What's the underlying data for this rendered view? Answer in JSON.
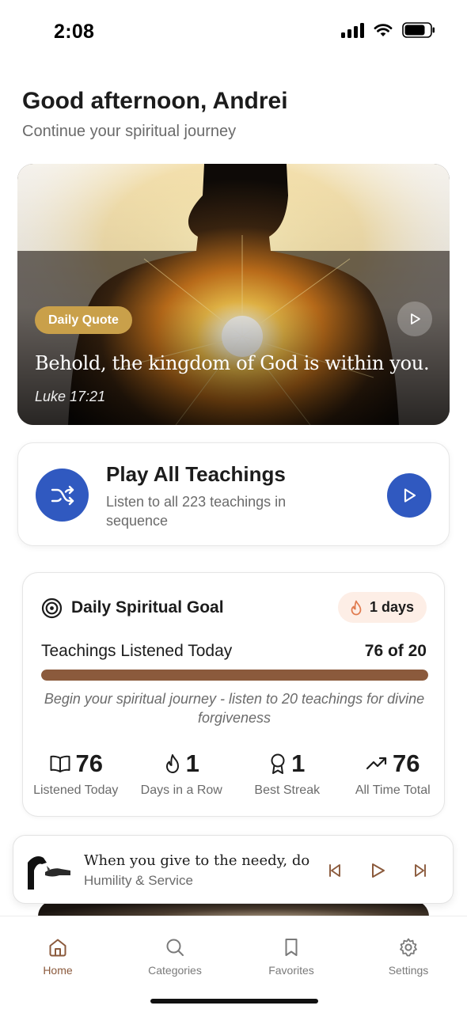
{
  "status_bar": {
    "time": "2:08"
  },
  "header": {
    "greeting": "Good afternoon, Andrei",
    "subtitle": "Continue your spiritual journey"
  },
  "hero": {
    "badge": "Daily Quote",
    "quote": "Behold, the kingdom of God is within you.",
    "reference": "Luke 17:21",
    "play_icon": "play-icon"
  },
  "play_all": {
    "title": "Play All Teachings",
    "subtitle": "Listen to all 223 teachings in sequence",
    "shuffle_icon": "shuffle-icon",
    "play_icon": "play-icon"
  },
  "goal": {
    "title": "Daily Spiritual Goal",
    "streak": "1 days",
    "progress_label": "Teachings Listened Today",
    "progress_value": "76 of 20",
    "progress_fraction": 1.0,
    "message": "Begin your spiritual journey - listen to 20 teachings for divine forgiveness",
    "stats": [
      {
        "icon": "book-icon",
        "value": "76",
        "label": "Listened Today"
      },
      {
        "icon": "flame-icon",
        "value": "1",
        "label": "Days in a Row"
      },
      {
        "icon": "award-icon",
        "value": "1",
        "label": "Best Streak"
      },
      {
        "icon": "trend-up-icon",
        "value": "76",
        "label": "All Time Total"
      }
    ]
  },
  "mini_player": {
    "title": "When you give to the needy, do n…",
    "category": "Humility & Service"
  },
  "tabs": [
    {
      "label": "Home",
      "icon": "home-icon",
      "active": true
    },
    {
      "label": "Categories",
      "icon": "search-icon",
      "active": false
    },
    {
      "label": "Favorites",
      "icon": "bookmark-icon",
      "active": false
    },
    {
      "label": "Settings",
      "icon": "gear-icon",
      "active": false
    }
  ],
  "colors": {
    "primary_blue": "#3059c0",
    "accent_brown": "#8b5a3c",
    "badge_gold": "#c9a04a",
    "streak_bg": "#fdeee6"
  }
}
